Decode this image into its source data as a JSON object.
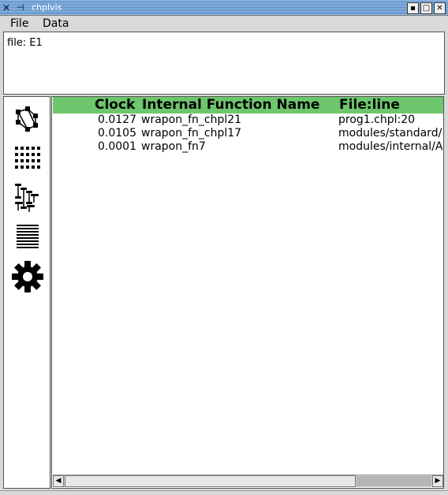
{
  "window": {
    "title": "chplvis",
    "minimize_glyph": "▪",
    "maximize_glyph": "□",
    "close_glyph": "✕"
  },
  "menubar": {
    "file_label": "File",
    "data_label": "Data"
  },
  "info": {
    "text": "file: E1"
  },
  "sidebar": {
    "buttons": [
      {
        "icon": "graph-icon"
      },
      {
        "icon": "grid-icon"
      },
      {
        "icon": "tree-icon"
      },
      {
        "icon": "list-icon"
      },
      {
        "icon": "gear-icon"
      }
    ]
  },
  "table": {
    "headers": {
      "clock": "Clock",
      "function": "Internal Function Name",
      "file": "File:line"
    },
    "rows": [
      {
        "clock": "0.0127",
        "function": "wrapon_fn_chpl21",
        "file": "prog1.chpl:20"
      },
      {
        "clock": "0.0105",
        "function": "wrapon_fn_chpl17",
        "file": "modules/standard/"
      },
      {
        "clock": "0.0001",
        "function": "wrapon_fn7",
        "file": "modules/internal/A"
      }
    ],
    "header_color": "#6ec66e"
  },
  "scrollbar": {
    "left_glyph": "◀",
    "right_glyph": "▶"
  }
}
